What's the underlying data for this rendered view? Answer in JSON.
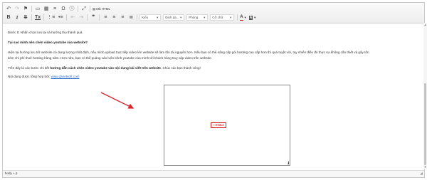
{
  "toolbar": {
    "row1": [
      {
        "name": "undo-icon",
        "glyph": "↶",
        "disabled": false
      },
      {
        "name": "redo-icon",
        "glyph": "↷",
        "disabled": true
      },
      {
        "name": "flag-icon",
        "glyph": "⚑",
        "disabled": false
      },
      {
        "name": "image-icon",
        "glyph": "▭",
        "disabled": false
      },
      {
        "name": "table-icon",
        "glyph": "▦",
        "disabled": false
      },
      {
        "name": "horizontal-line-icon",
        "glyph": "≡",
        "disabled": false
      },
      {
        "name": "special-char-icon",
        "glyph": "Ω",
        "disabled": false
      },
      {
        "name": "help-icon",
        "glyph": "ⓘ",
        "disabled": false
      },
      {
        "name": "fullscreen-icon",
        "glyph": "⤢",
        "disabled": false
      }
    ],
    "html_label": "Mã HTML",
    "row2_format": [
      {
        "name": "bold-icon",
        "glyph": "B",
        "cls": "bold"
      },
      {
        "name": "italic-icon",
        "glyph": "I",
        "cls": "ital"
      },
      {
        "name": "strikethrough-icon",
        "glyph": "S",
        "cls": "strike"
      },
      {
        "name": "clear-format-icon",
        "glyph": "Tx",
        "cls": "under"
      }
    ],
    "row2_lists": [
      {
        "name": "numbered-list-icon",
        "glyph": "⋮≡"
      },
      {
        "name": "bullet-list-icon",
        "glyph": "•≡"
      },
      {
        "name": "outdent-icon",
        "glyph": "⇤"
      },
      {
        "name": "indent-icon",
        "glyph": "⇥"
      },
      {
        "name": "blockquote-icon",
        "glyph": "❞"
      }
    ],
    "row2_align": [
      {
        "name": "align-left-icon",
        "glyph": "≡"
      },
      {
        "name": "align-center-icon",
        "glyph": "≡"
      },
      {
        "name": "align-right-icon",
        "glyph": "≡"
      },
      {
        "name": "align-justify-icon",
        "glyph": "≣"
      }
    ],
    "style_combo": "Kiểu",
    "format_combo": "Định dạ...",
    "font_combo": "Phông",
    "size_combo": "Cỡ chữ",
    "text_color_glyph": "A",
    "bg_color_glyph": "A"
  },
  "content": {
    "step_prefix": "Bước 8: Nhấn chọn lưu lại và hưởng thụ thành quả.",
    "heading": "Tại sao mình nên chèn video youtube vào website?",
    "paragraph_line1": "Hiện tại hướng lưu trữ website có dung lượng nhất định, nếu mình upload trực tiếp video lên website sẽ làm tốn tài nguyên hơn. Nếu bạn có thể nâng cấp gói hosting cao cấp hơn thì quá tuyệt vời, tuy nhiên điều đó thực sự không cần thiết và gây tốn",
    "paragraph_line2": "kém chi phí thuê hosting hàng năm. Hơn nữa, bạn có thể quảng cáo luôn kênh youtube của mình tới khách hàng truy cập video trên website.",
    "summary_prefix": "Trên đây là các bước chi tiết ",
    "summary_bold": "hướng dẫn cách chèn video youtube vào nội dung bài viết trên website",
    "summary_suffix": ". Chúc các bạn thành công!",
    "source_prefix": "Nội dung được tổng hợp bởi: ",
    "source_link": "www.danetsoft.com"
  },
  "video": {
    "badge_text": "≡ HTML5"
  },
  "statusbar": {
    "path_body": "body",
    "path_sep": "»",
    "path_p": "p",
    "grip": "◢"
  },
  "colors": {
    "arrow": "#d42a2a",
    "link": "#2a6fc9",
    "badge": "#d21f1f"
  }
}
